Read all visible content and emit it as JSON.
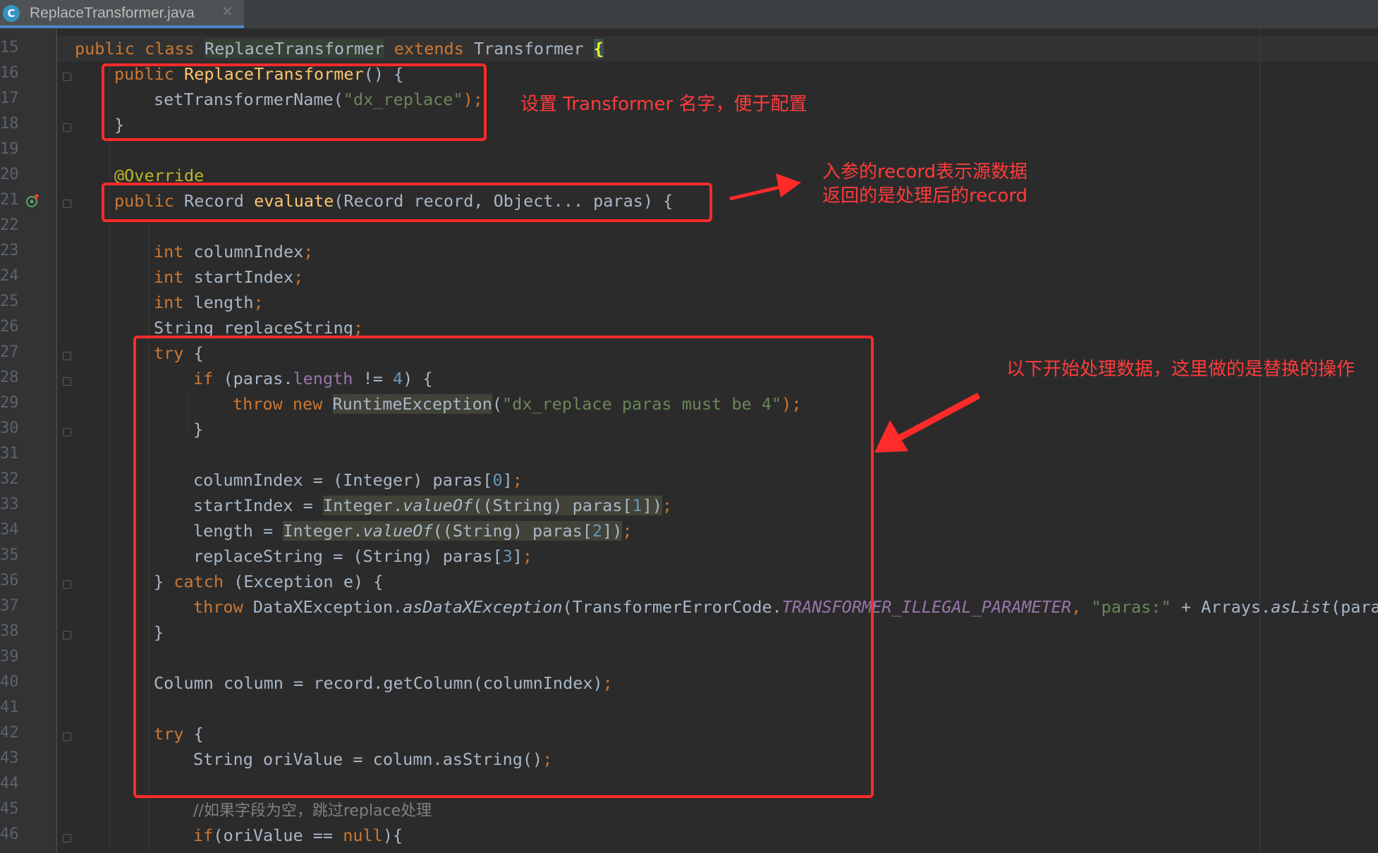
{
  "tab": {
    "icon_letter": "C",
    "title": "ReplaceTransformer.java",
    "close": "✕"
  },
  "line_numbers": [
    "15",
    "16",
    "17",
    "18",
    "19",
    "20",
    "21",
    "22",
    "23",
    "24",
    "25",
    "26",
    "27",
    "28",
    "29",
    "30",
    "31",
    "32",
    "33",
    "34",
    "35",
    "36",
    "37",
    "38",
    "39",
    "40",
    "41",
    "42",
    "43",
    "44",
    "45",
    "46"
  ],
  "code": {
    "l15": {
      "kw_public": "public",
      "kw_class": "class",
      "name": "ReplaceTransformer",
      "kw_extends": "extends",
      "parent": "Transformer",
      "brace": "{"
    },
    "l16": {
      "kw_public": "public",
      "ctor": "ReplaceTransformer",
      "rest": "() {"
    },
    "l17": {
      "call": "setTransformerName(",
      "str": "\"dx_replace\"",
      "end": ");"
    },
    "l18": {
      "text": "}"
    },
    "l20": {
      "annotation": "@Override"
    },
    "l21": {
      "kw_public": "public",
      "type": "Record",
      "method": "evaluate",
      "params": "(Record record, Object... paras) {"
    },
    "l23": {
      "kw": "int",
      "name": "columnIndex",
      "semi": ";"
    },
    "l24": {
      "kw": "int",
      "name": "startIndex",
      "semi": ";"
    },
    "l25": {
      "kw": "int",
      "name": "length",
      "semi": ";"
    },
    "l26": {
      "text": "String replaceString",
      "semi": ";"
    },
    "l27": {
      "kw": "try",
      "rest": "{"
    },
    "l28": {
      "kw": "if",
      "open": "(paras.",
      "field": "length",
      "op": "!=",
      "num": "4",
      "rest": ") {"
    },
    "l29": {
      "kw_throw": "throw",
      "kw_new": "new",
      "cls": "RuntimeException",
      "open": "(",
      "str": "\"dx_replace paras must be 4\"",
      "end": ");"
    },
    "l30": {
      "text": "}"
    },
    "l32": {
      "text": "columnIndex = (Integer) paras[",
      "num": "0",
      "end": "]",
      "semi": ";"
    },
    "l33": {
      "text": "startIndex = ",
      "cls": "Integer.",
      "m": "valueOf",
      "args": "((String) paras[",
      "num": "1",
      "end": "])",
      "semi": ";"
    },
    "l34": {
      "text": "length = ",
      "cls": "Integer.",
      "m": "valueOf",
      "args": "((String) paras[",
      "num": "2",
      "end": "])",
      "semi": ";"
    },
    "l35": {
      "text": "replaceString = (String) paras[",
      "num": "3",
      "end": "]",
      "semi": ";"
    },
    "l36": {
      "close": "}",
      "kw": "catch",
      "rest": "(Exception e) {"
    },
    "l37": {
      "kw": "throw",
      "cls": "DataXException.",
      "m": "asDataXException",
      "mid": "(TransformerErrorCode.",
      "constant": "TRANSFORMER_ILLEGAL_PARAMETER",
      "comma": ",",
      "str": "\"paras:\"",
      "plus": "+ Arrays.",
      "m2": "asList",
      "tail": "(paras"
    },
    "l38": {
      "text": "}"
    },
    "l40": {
      "text": "Column column = record.getColumn(columnIndex)",
      "semi": ";"
    },
    "l42": {
      "kw": "try",
      "rest": "{"
    },
    "l43": {
      "text": "String oriValue = column.asString()",
      "semi": ";"
    },
    "l45": {
      "comment": "//如果字段为空，跳过replace处理"
    },
    "l46": {
      "kw": "if",
      "open": "(oriValue == ",
      "kw_null": "null",
      "rest": "){"
    }
  },
  "annotations": {
    "note1": "设置 Transformer 名字，便于配置",
    "note2_line1": "入参的record表示源数据",
    "note2_line2": "返回的是处理后的record",
    "note3": "以下开始处理数据，这里做的是替换的操作"
  },
  "colors": {
    "annotation_red": "#ff2a2a",
    "keyword": "#cc7832",
    "string": "#6a8759",
    "number": "#6897bb",
    "function": "#ffc66d",
    "field": "#9876aa",
    "editor_bg": "#2b2b2b"
  }
}
